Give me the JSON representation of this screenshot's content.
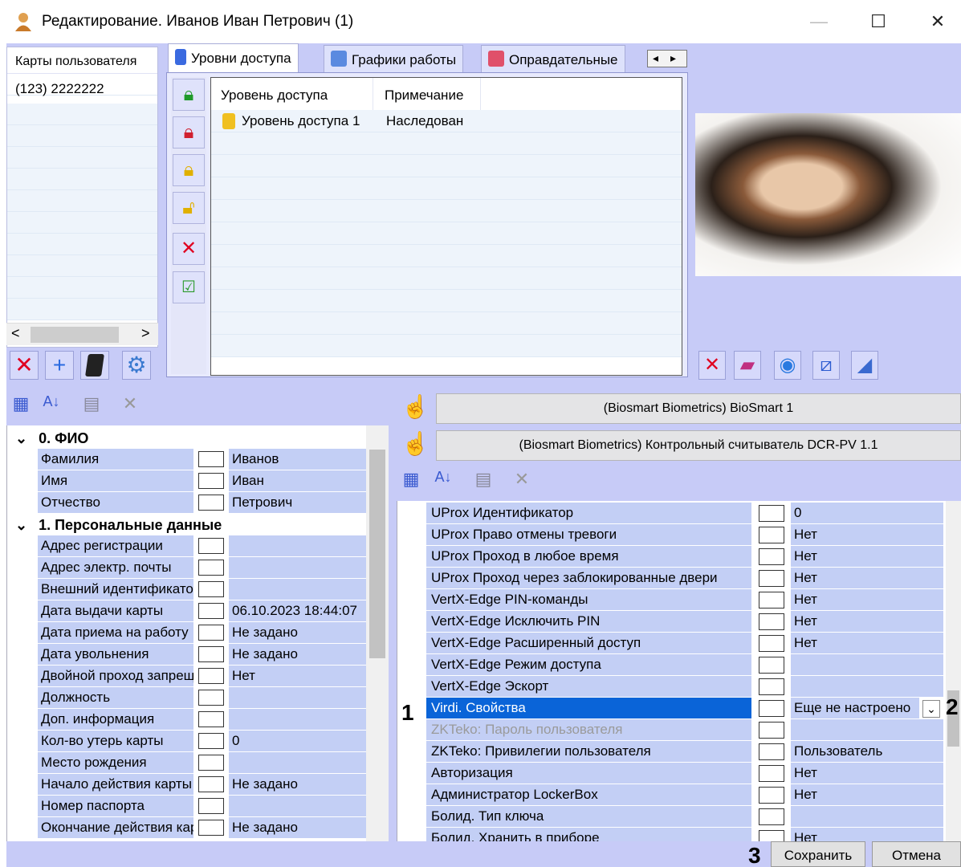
{
  "window": {
    "title": "Редактирование. Иванов Иван Петрович (1)",
    "minimize": "—",
    "maximize": "☐",
    "close": "✕"
  },
  "cards": {
    "header": "Карты пользователя",
    "items": [
      "(123) 2222222"
    ],
    "scroll_left": "<",
    "scroll_right": ">"
  },
  "tabs": [
    {
      "label": "Уровни доступа",
      "active": true
    },
    {
      "label": "Графики работы",
      "active": false
    },
    {
      "label": "Оправдательные",
      "active": false
    }
  ],
  "tab_scroll": {
    "left": "◂",
    "right": "▸"
  },
  "access_table": {
    "columns": [
      "Уровень доступа",
      "Примечание"
    ],
    "rows": [
      {
        "level": "Уровень доступа 1",
        "note": "Наследован"
      }
    ]
  },
  "devices": [
    "(Biosmart Biometrics) BioSmart 1",
    "(Biosmart Biometrics) Контрольный считыватель DCR-PV 1.1"
  ],
  "left_grid": {
    "categories": [
      {
        "name": "0. ФИО",
        "rows": [
          {
            "name": "Фамилия",
            "value": "Иванов"
          },
          {
            "name": "Имя",
            "value": "Иван"
          },
          {
            "name": "Отчество",
            "value": "Петрович"
          }
        ]
      },
      {
        "name": "1. Персональные данные",
        "rows": [
          {
            "name": "Адрес регистрации",
            "value": ""
          },
          {
            "name": "Адрес электр. почты",
            "value": ""
          },
          {
            "name": "Внешний идентификатор",
            "value": ""
          },
          {
            "name": "Дата выдачи карты",
            "value": "06.10.2023 18:44:07"
          },
          {
            "name": "Дата приема на работу",
            "value": "Не задано"
          },
          {
            "name": "Дата увольнения",
            "value": "Не задано"
          },
          {
            "name": "Двойной проход запрещен",
            "value": "Нет"
          },
          {
            "name": "Должность",
            "value": ""
          },
          {
            "name": "Доп. информация",
            "value": ""
          },
          {
            "name": "Кол-во утерь карты",
            "value": "0"
          },
          {
            "name": "Место рождения",
            "value": ""
          },
          {
            "name": "Начало действия карты",
            "value": "Не задано"
          },
          {
            "name": "Номер паспорта",
            "value": ""
          },
          {
            "name": "Окончание действия карты",
            "value": "Не задано"
          }
        ]
      }
    ]
  },
  "right_grid": {
    "rows": [
      {
        "name": "UProx Идентификатор",
        "value": "0"
      },
      {
        "name": "UProx Право отмены тревоги",
        "value": "Нет"
      },
      {
        "name": "UProx Проход в любое время",
        "value": "Нет"
      },
      {
        "name": "UProx Проход через заблокированные двери",
        "value": "Нет"
      },
      {
        "name": "VertX-Edge PIN-команды",
        "value": "Нет"
      },
      {
        "name": "VertX-Edge Исключить PIN",
        "value": "Нет"
      },
      {
        "name": "VertX-Edge Расширенный доступ",
        "value": "Нет"
      },
      {
        "name": "VertX-Edge Режим доступа",
        "value": ""
      },
      {
        "name": "VertX-Edge Эскорт",
        "value": ""
      },
      {
        "name": "Virdi. Свойства",
        "value": "Еще не настроено",
        "selected": true
      },
      {
        "name": "ZKTeko: Пароль пользователя",
        "value": "",
        "disabled": true
      },
      {
        "name": "ZKTeko: Привилегии пользователя",
        "value": "Пользователь"
      },
      {
        "name": "Авторизация",
        "value": "Нет"
      },
      {
        "name": "Администратор LockerBox",
        "value": "Нет"
      },
      {
        "name": "Болид. Тип ключа",
        "value": ""
      },
      {
        "name": "Болид. Хранить в приборе",
        "value": "Нет"
      }
    ]
  },
  "callouts": [
    "1",
    "2",
    "3"
  ],
  "buttons": {
    "save": "Сохранить",
    "cancel": "Отмена"
  },
  "colors": {
    "selection": "#0a64d8",
    "panel_bg": "#c7cbf7",
    "grid_row": "#c3cff5"
  }
}
